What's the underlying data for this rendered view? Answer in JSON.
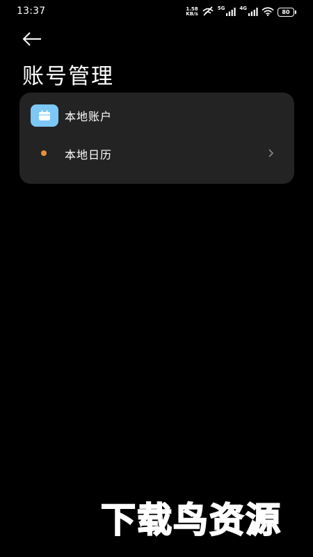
{
  "status_bar": {
    "time": "13:37",
    "net_speed_value": "1.58",
    "net_speed_unit": "KB/s",
    "sim1_label": "5G",
    "sim2_label": "4G",
    "battery": "80"
  },
  "header": {
    "title": "账号管理"
  },
  "account": {
    "name": "本地账户",
    "calendars": [
      {
        "label": "本地日历",
        "color": "#e8913a"
      }
    ]
  },
  "colors": {
    "background": "#000000",
    "card": "#232323",
    "app_icon": "#7dc7f5",
    "calendar_dot": "#e8913a"
  },
  "watermark": {
    "text": "下载鸟资源"
  }
}
